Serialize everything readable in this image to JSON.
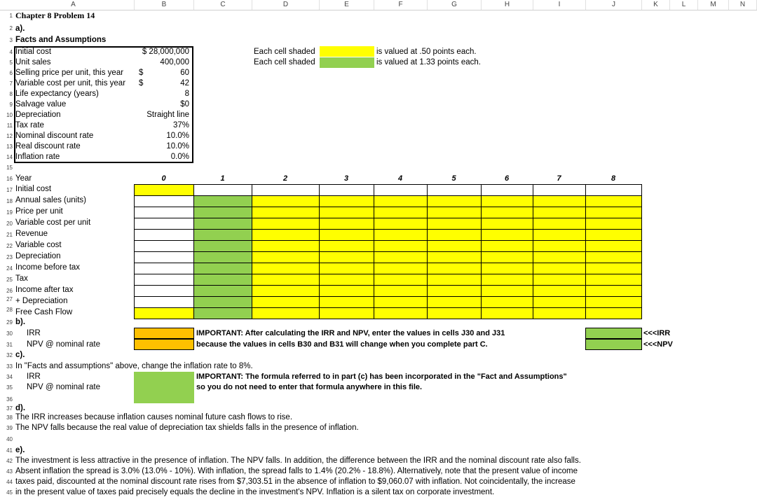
{
  "columns": [
    "A",
    "B",
    "C",
    "D",
    "E",
    "F",
    "G",
    "H",
    "I",
    "J",
    "K",
    "L",
    "M",
    "N"
  ],
  "title": "Chapter 8 Problem 14",
  "part_a": "a).",
  "facts_header": "Facts and Assumptions",
  "facts": [
    {
      "label": "Initial cost",
      "cur": "",
      "value": "$ 28,000,000"
    },
    {
      "label": "Unit sales",
      "cur": "",
      "value": "400,000"
    },
    {
      "label": "Selling price per unit, this year",
      "cur": "$",
      "value": "60"
    },
    {
      "label": "Variable cost per unit, this year",
      "cur": "$",
      "value": "42"
    },
    {
      "label": "Life expectancy (years)",
      "cur": "",
      "value": "8"
    },
    {
      "label": "Salvage value",
      "cur": "",
      "value": "$0"
    },
    {
      "label": "Depreciation",
      "cur": "",
      "value": "Straight line"
    },
    {
      "label": "Tax rate",
      "cur": "",
      "value": "37%"
    },
    {
      "label": "Nominal discount rate",
      "cur": "",
      "value": "10.0%"
    },
    {
      "label": "Real discount rate",
      "cur": "",
      "value": "10.0%"
    },
    {
      "label": "Inflation rate",
      "cur": "",
      "value": "0.0%"
    }
  ],
  "legend": {
    "line1_pre": "Each cell shaded",
    "line1_post": "is valued at .50 points each.",
    "line2_pre": "Each cell shaded",
    "line2_post": "is valued at 1.33 points each.",
    "yellow": "#ffff00",
    "green": "#92d050"
  },
  "year_label": "Year",
  "years": [
    "0",
    "1",
    "2",
    "3",
    "4",
    "5",
    "6",
    "7",
    "8"
  ],
  "row_labels": [
    "Initial  cost",
    "Annual sales (units)",
    "Price per unit",
    "Variable cost per unit",
    "Revenue",
    "Variable cost",
    "Depreciation",
    "Income before tax",
    "Tax",
    "Income after tax",
    "+ Depreciation",
    "Free Cash Flow"
  ],
  "part_b": "b).",
  "irr_label": "IRR",
  "npv_label": "NPV @ nominal rate",
  "important_b1": "IMPORTANT:  After calculating the IRR and NPV, enter the values in cells J30 and J31",
  "important_b2": "because the values in cells B30 and B31 will change when you complete part C.",
  "irr_arrow": "<<<IRR",
  "npv_arrow": "<<<NPV",
  "part_c": "c).",
  "part_c_text": "In \"Facts and assumptions\" above, change the inflation rate to 8%.",
  "important_c1": "IMPORTANT:  The formula referred to in part (c) has been incorporated in the \"Fact and Assumptions\"",
  "important_c2": "so you do not need to enter that formula anywhere in this file.",
  "part_d": "d).",
  "d_lines": [
    "The IRR increases because inflation causes nominal future cash flows to rise.",
    "The NPV falls because the real value of depreciation tax shields falls in the presence of inflation."
  ],
  "part_e": "e).",
  "e_lines": [
    "The investment is less attractive in the presence of inflation.  The NPV falls.  In addition, the difference between the IRR and the nominal discount rate also falls.",
    "Absent inflation the spread is 3.0% (13.0% - 10%).  With inflation, the spread falls to 1.4% (20.2% - 18.8%).  Alternatively, note that the present value of income",
    "taxes paid, discounted at the nominal discount rate rises from $7,303.51 in the absence of inflation to $9,060.07 with inflation.  Not coincidentally, the increase",
    "in the present value of taxes paid precisely equals the decline in the investment's NPV.  Inflation is a silent tax on corporate investment."
  ],
  "row_numbers": [
    "1",
    "2",
    "3",
    "4",
    "5",
    "6",
    "7",
    "8",
    "9",
    "10",
    "11",
    "12",
    "13",
    "14",
    "15",
    "16",
    "17",
    "18",
    "19",
    "20",
    "21",
    "22",
    "23",
    "24",
    "25",
    "26",
    "27",
    "28",
    "29",
    "30",
    "31",
    "32",
    "33",
    "34",
    "35",
    "36",
    "37",
    "38",
    "39",
    "40",
    "41",
    "42",
    "43",
    "44",
    "45"
  ]
}
